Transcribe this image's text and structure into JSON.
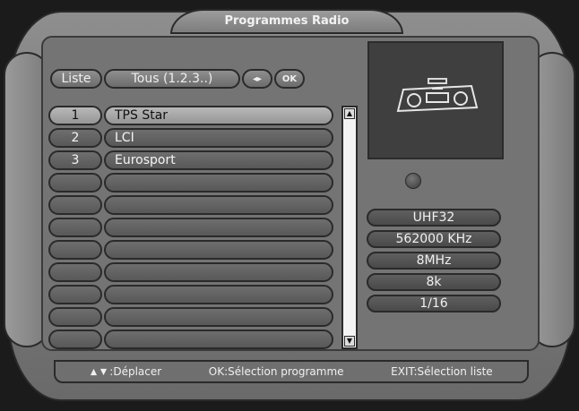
{
  "header": {
    "title": "Programmes Radio"
  },
  "liste": {
    "label": "Liste",
    "value": "Tous (1.2.3..)",
    "arrows_label": "◂▸",
    "ok_label": "OK"
  },
  "channels": [
    {
      "num": "1",
      "name": "TPS Star",
      "selected": true
    },
    {
      "num": "2",
      "name": "LCI",
      "selected": false
    },
    {
      "num": "3",
      "name": "Eurosport",
      "selected": false
    },
    {
      "num": "",
      "name": "",
      "selected": false
    },
    {
      "num": "",
      "name": "",
      "selected": false
    },
    {
      "num": "",
      "name": "",
      "selected": false
    },
    {
      "num": "",
      "name": "",
      "selected": false
    },
    {
      "num": "",
      "name": "",
      "selected": false
    },
    {
      "num": "",
      "name": "",
      "selected": false
    },
    {
      "num": "",
      "name": "",
      "selected": false
    },
    {
      "num": "",
      "name": "",
      "selected": false
    }
  ],
  "preview": {
    "icon": "radio-cassette-icon"
  },
  "info": {
    "band": "UHF32",
    "frequency": "562000 KHz",
    "bandwidth": "8MHz",
    "mode": "8k",
    "guard": "1/16"
  },
  "footer": {
    "move": ":Déplacer",
    "ok": "OK:Sélection programme",
    "exit": "EXIT:Sélection liste"
  },
  "colors": {
    "selected_row": "#b3b3b3",
    "row": "#646464",
    "frame": "#7f7f7f",
    "scrollbar": "#f4f4f4"
  }
}
